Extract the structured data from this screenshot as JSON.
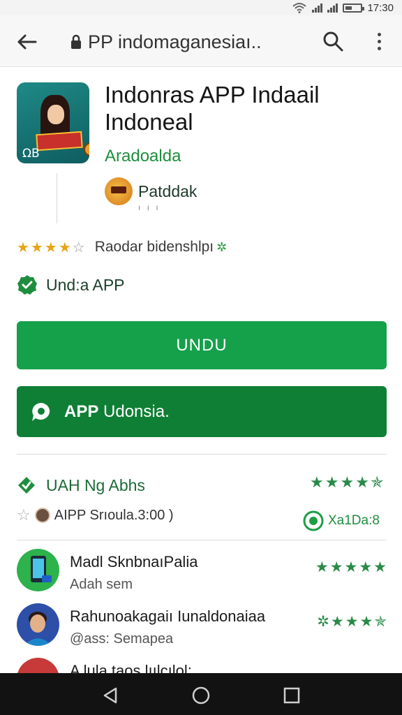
{
  "status_bar": {
    "time": "17:30"
  },
  "toolbar": {
    "url": "PP indomaganesiaı.."
  },
  "app": {
    "title": "Indonras APP Indaail Indoneal",
    "developer": "Aradoalda",
    "badge_label": "Patddak",
    "badge_sub": "ı ı ı",
    "rating_text": "Raodar bidenshlpı",
    "verified_label": "Und:a APP"
  },
  "buttons": {
    "install_label": "UNDU",
    "open_label_bold": "APP",
    "open_label_rest": "Udonsia."
  },
  "reviews": {
    "title": "UAH Ng Abhs",
    "subtitle": "AIPP Srıoula.3:00 )",
    "count_label": "Xa1Da:8",
    "items": [
      {
        "name": "Madl SknbnaıPalia",
        "sub": "Adah sem"
      },
      {
        "name": "Rahunoakagaiı Iunaldonaiaa",
        "sub": "@ass: Semapea"
      },
      {
        "name": "A lula taos lıılcılol:",
        "sub": ""
      }
    ]
  },
  "colors": {
    "primary_green": "#15a04a",
    "dark_green": "#0f7f35",
    "star_gold": "#e8a317",
    "nav_bar": "#121212"
  },
  "icons": {
    "back": "arrow-back-icon",
    "lock": "lock-icon",
    "search": "search-icon",
    "more": "more-vert-icon",
    "verified": "verified-check-icon",
    "chat": "chat-bubble-icon",
    "nav_back": "triangle-back-icon",
    "nav_home": "circle-home-icon",
    "nav_recents": "square-recents-icon"
  }
}
